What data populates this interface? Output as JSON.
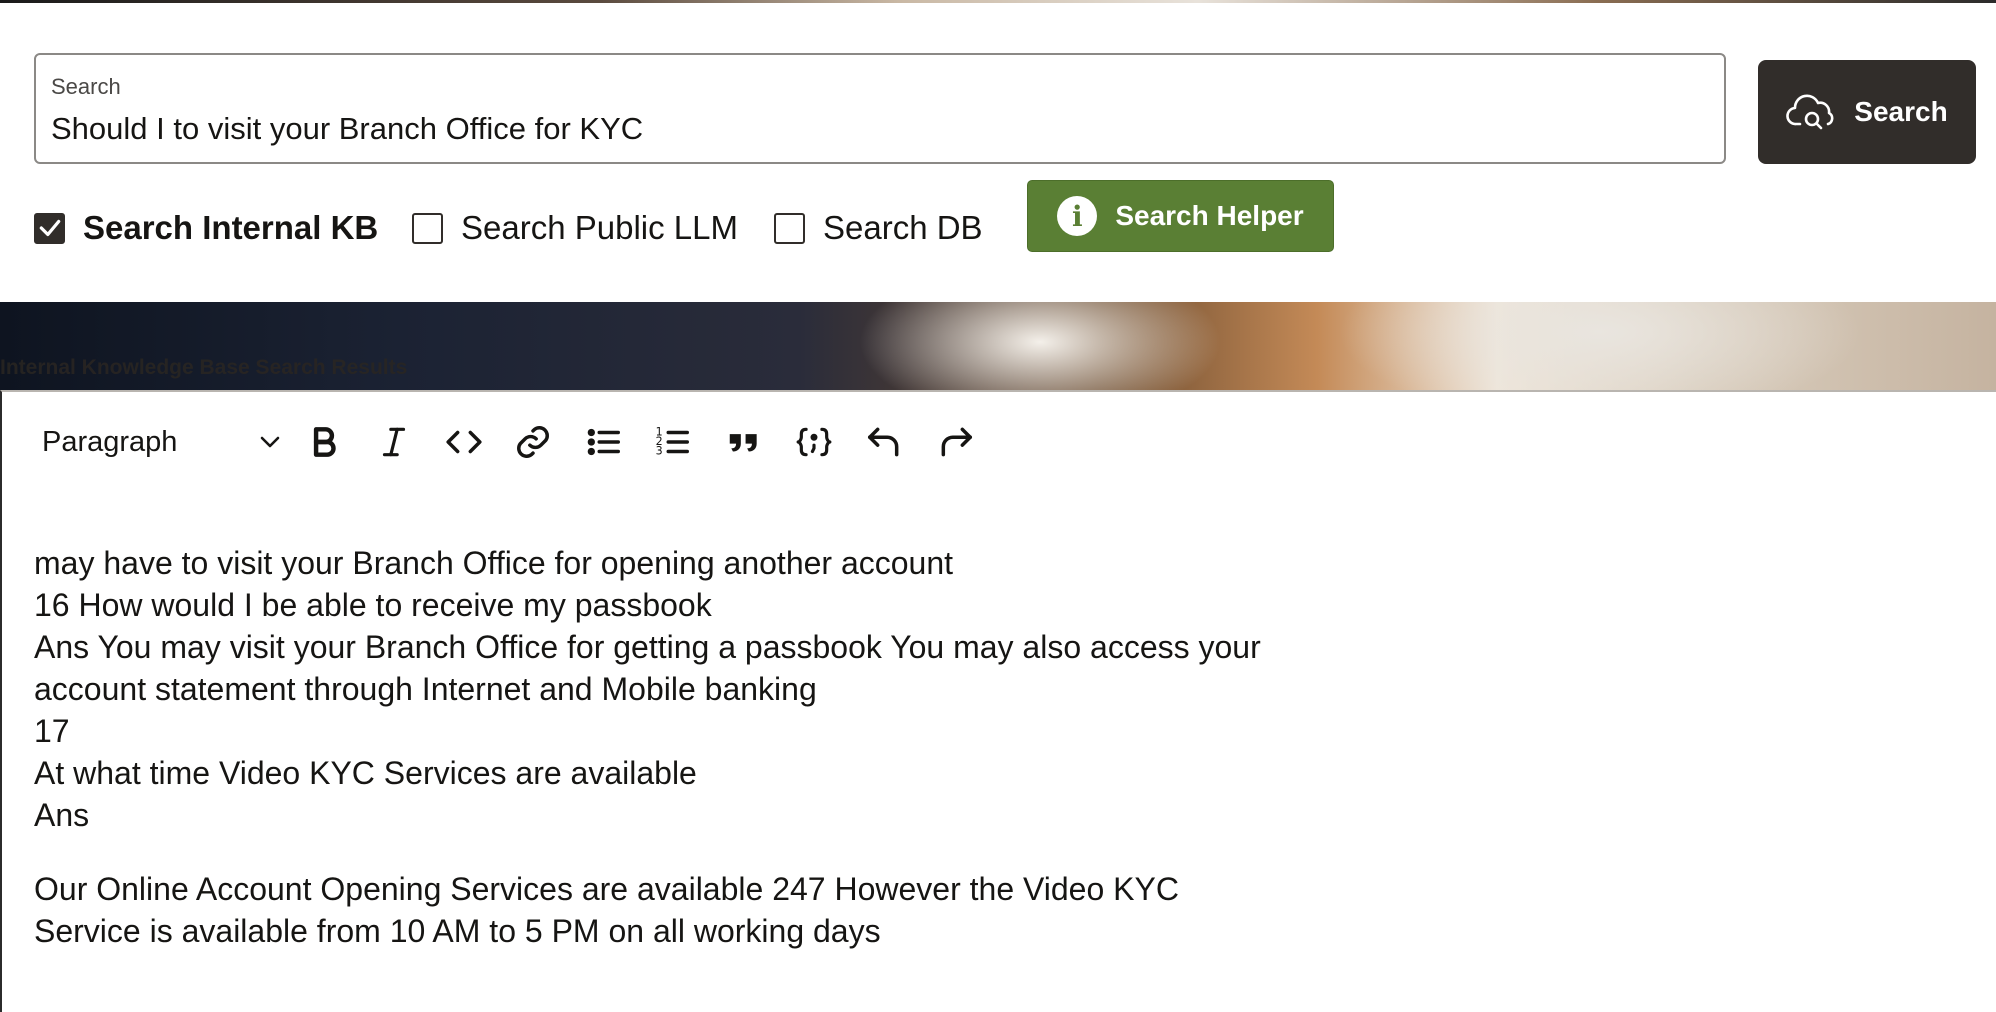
{
  "search": {
    "label": "Search",
    "value": "Should I to visit your Branch Office for KYC",
    "button_label": "Search"
  },
  "options": [
    {
      "label": "Search Internal KB",
      "checked": true
    },
    {
      "label": "Search Public LLM",
      "checked": false
    },
    {
      "label": "Search DB",
      "checked": false
    }
  ],
  "helper": {
    "label": "Search Helper"
  },
  "results": {
    "title": "Internal Knowledge Base Search Results"
  },
  "editor": {
    "block_format": "Paragraph",
    "toolbar_icons": [
      "bold-icon",
      "italic-icon",
      "code-icon",
      "link-icon",
      "bulleted-list-icon",
      "numbered-list-icon",
      "quote-icon",
      "code-block-icon",
      "undo-icon",
      "redo-icon"
    ],
    "lines_block1": [
      "may have to visit your Branch Office for opening another account",
      "16 How would I be able to receive my passbook",
      "Ans You may visit your Branch Office for getting a passbook You may also access your",
      "account statement through Internet and Mobile banking",
      "17",
      "At what time Video KYC Services are available",
      "Ans"
    ],
    "lines_block2": [
      "Our Online Account Opening Services are available 247 However the Video KYC",
      "Service is available from 10 AM to 5 PM on all working days"
    ]
  },
  "colors": {
    "search_button": "#312d2a",
    "helper_button": "#5a7f34",
    "text": "#161513"
  }
}
